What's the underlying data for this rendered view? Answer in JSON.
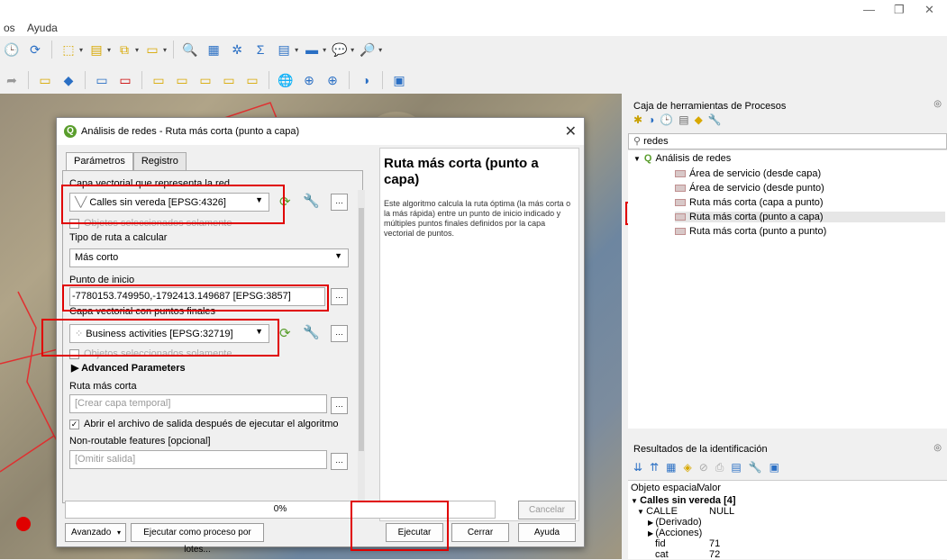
{
  "menu": {
    "item1": "os",
    "item2": "Ayuda"
  },
  "dialog": {
    "title": "Análisis de redes - Ruta más corta (punto a capa)",
    "tabs": [
      "Parámetros",
      "Registro"
    ],
    "layer_label": "Capa vectorial que representa la red",
    "layer_value": "Calles sin vereda [EPSG:4326]",
    "layer_selected_only": "Objetos seleccionados solamente",
    "route_type_label": "Tipo de ruta a calcular",
    "route_type_value": "Más corto",
    "start_label": "Punto de inicio",
    "start_value": "-7780153.749950,-1792413.149687 [EPSG:3857]",
    "end_layer_label": "Capa vectorial con puntos finales",
    "end_layer_value": "Business activities [EPSG:32719]",
    "end_selected_only": "Objetos seleccionados solamente",
    "advanced": "Advanced Parameters",
    "shortest_label": "Ruta más corta",
    "shortest_placeholder": "[Crear capa temporal]",
    "open_output": "Abrir el archivo de salida después de ejecutar el algoritmo",
    "nonroutable_label": "Non-routable features [opcional]",
    "nonroutable_placeholder": "[Omitir salida]",
    "help_title": "Ruta más corta (punto a capa)",
    "help_text": "Este algoritmo calcula la ruta óptima (la más corta o la más rápida) entre un punto de inicio indicado y múltiples puntos finales definidos por la capa vectorial de puntos.",
    "progress": "0%",
    "cancel": "Cancelar",
    "advanced_btn": "Avanzado",
    "batch_btn": "Ejecutar como proceso por lotes...",
    "run": "Ejecutar",
    "close": "Cerrar",
    "help": "Ayuda"
  },
  "toolbox": {
    "title": "Caja de herramientas de Procesos",
    "search": "redes",
    "group": "Análisis de redes",
    "items": [
      "Área de servicio (desde capa)",
      "Área de servicio (desde punto)",
      "Ruta más corta (capa a punto)",
      "Ruta más corta (punto a capa)",
      "Ruta más corta (punto a punto)"
    ]
  },
  "identify": {
    "title": "Resultados de la identificación",
    "col1": "Objeto espacial",
    "col2": "Valor",
    "layer": "Calles sin vereda",
    "count": "[4]",
    "field1": "CALLE",
    "field1_val": "NULL",
    "derived": "(Derivado)",
    "actions": "(Acciones)",
    "fid_label": "fid",
    "fid_val": "71",
    "cat_label": "cat",
    "cat_val": "72"
  }
}
